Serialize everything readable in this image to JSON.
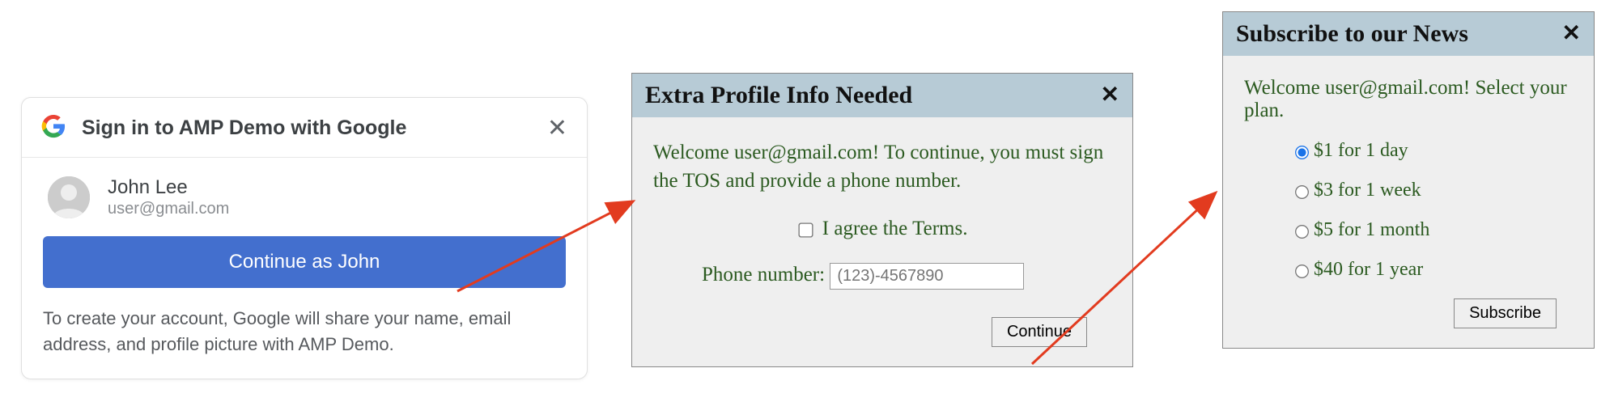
{
  "google_card": {
    "title": "Sign in to AMP Demo with Google",
    "name": "John Lee",
    "email": "user@gmail.com",
    "continue_label": "Continue as John",
    "disclaimer": "To create your account, Google will share your name, email address, and profile picture with AMP Demo."
  },
  "profile_dialog": {
    "title": "Extra Profile Info Needed",
    "welcome": "Welcome user@gmail.com! To continue, you must sign the TOS and provide a phone number.",
    "terms_label": "I agree the Terms.",
    "phone_label": "Phone number: ",
    "phone_placeholder": "(123)-4567890",
    "continue_label": "Continue"
  },
  "subscribe_dialog": {
    "title": "Subscribe to our News",
    "welcome": "Welcome user@gmail.com! Select your plan.",
    "plans": [
      {
        "label": "$1 for 1 day",
        "checked": true
      },
      {
        "label": "$3 for 1 week",
        "checked": false
      },
      {
        "label": "$5 for 1 month",
        "checked": false
      },
      {
        "label": "$40 for 1 year",
        "checked": false
      }
    ],
    "subscribe_label": "Subscribe"
  }
}
